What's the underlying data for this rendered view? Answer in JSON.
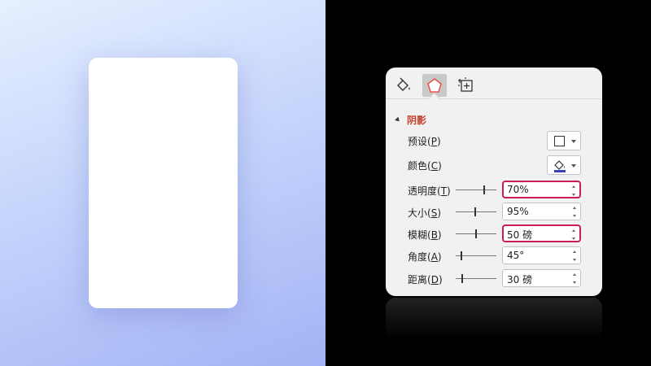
{
  "panel": {
    "tabs": [
      {
        "name": "fill-line",
        "icon": "paint-bucket-icon",
        "active": false
      },
      {
        "name": "effects",
        "icon": "pentagon-icon",
        "active": true
      },
      {
        "name": "size-properties",
        "icon": "size-position-icon",
        "active": false
      }
    ],
    "section": {
      "title": "阴影",
      "expanded": true
    },
    "rows": {
      "preset": {
        "label": "预设(",
        "hotkey": "P",
        "suffix": ")"
      },
      "color": {
        "label": "颜色(",
        "hotkey": "C",
        "suffix": ")"
      },
      "transparency": {
        "label": "透明度(",
        "hotkey": "T",
        "suffix": ")",
        "value": "70%",
        "slider": 0.7,
        "highlighted": true
      },
      "size": {
        "label": "大小(",
        "hotkey": "S",
        "suffix": ")",
        "value": "95%",
        "slider": 0.48,
        "highlighted": false
      },
      "blur": {
        "label": "模糊(",
        "hotkey": "B",
        "suffix": ")",
        "value": "50 磅",
        "slider": 0.5,
        "highlighted": true
      },
      "angle": {
        "label": "角度(",
        "hotkey": "A",
        "suffix": ")",
        "value": "45°",
        "slider": 0.12,
        "highlighted": false
      },
      "distance": {
        "label": "距离(",
        "hotkey": "D",
        "suffix": ")",
        "value": "30 磅",
        "slider": 0.15,
        "highlighted": false
      }
    }
  },
  "colors": {
    "highlight_border": "#cd1a5d",
    "section_title": "#c5412e",
    "effects_icon": "#e8554d",
    "fill_color_bar": "#3a3fbf"
  }
}
